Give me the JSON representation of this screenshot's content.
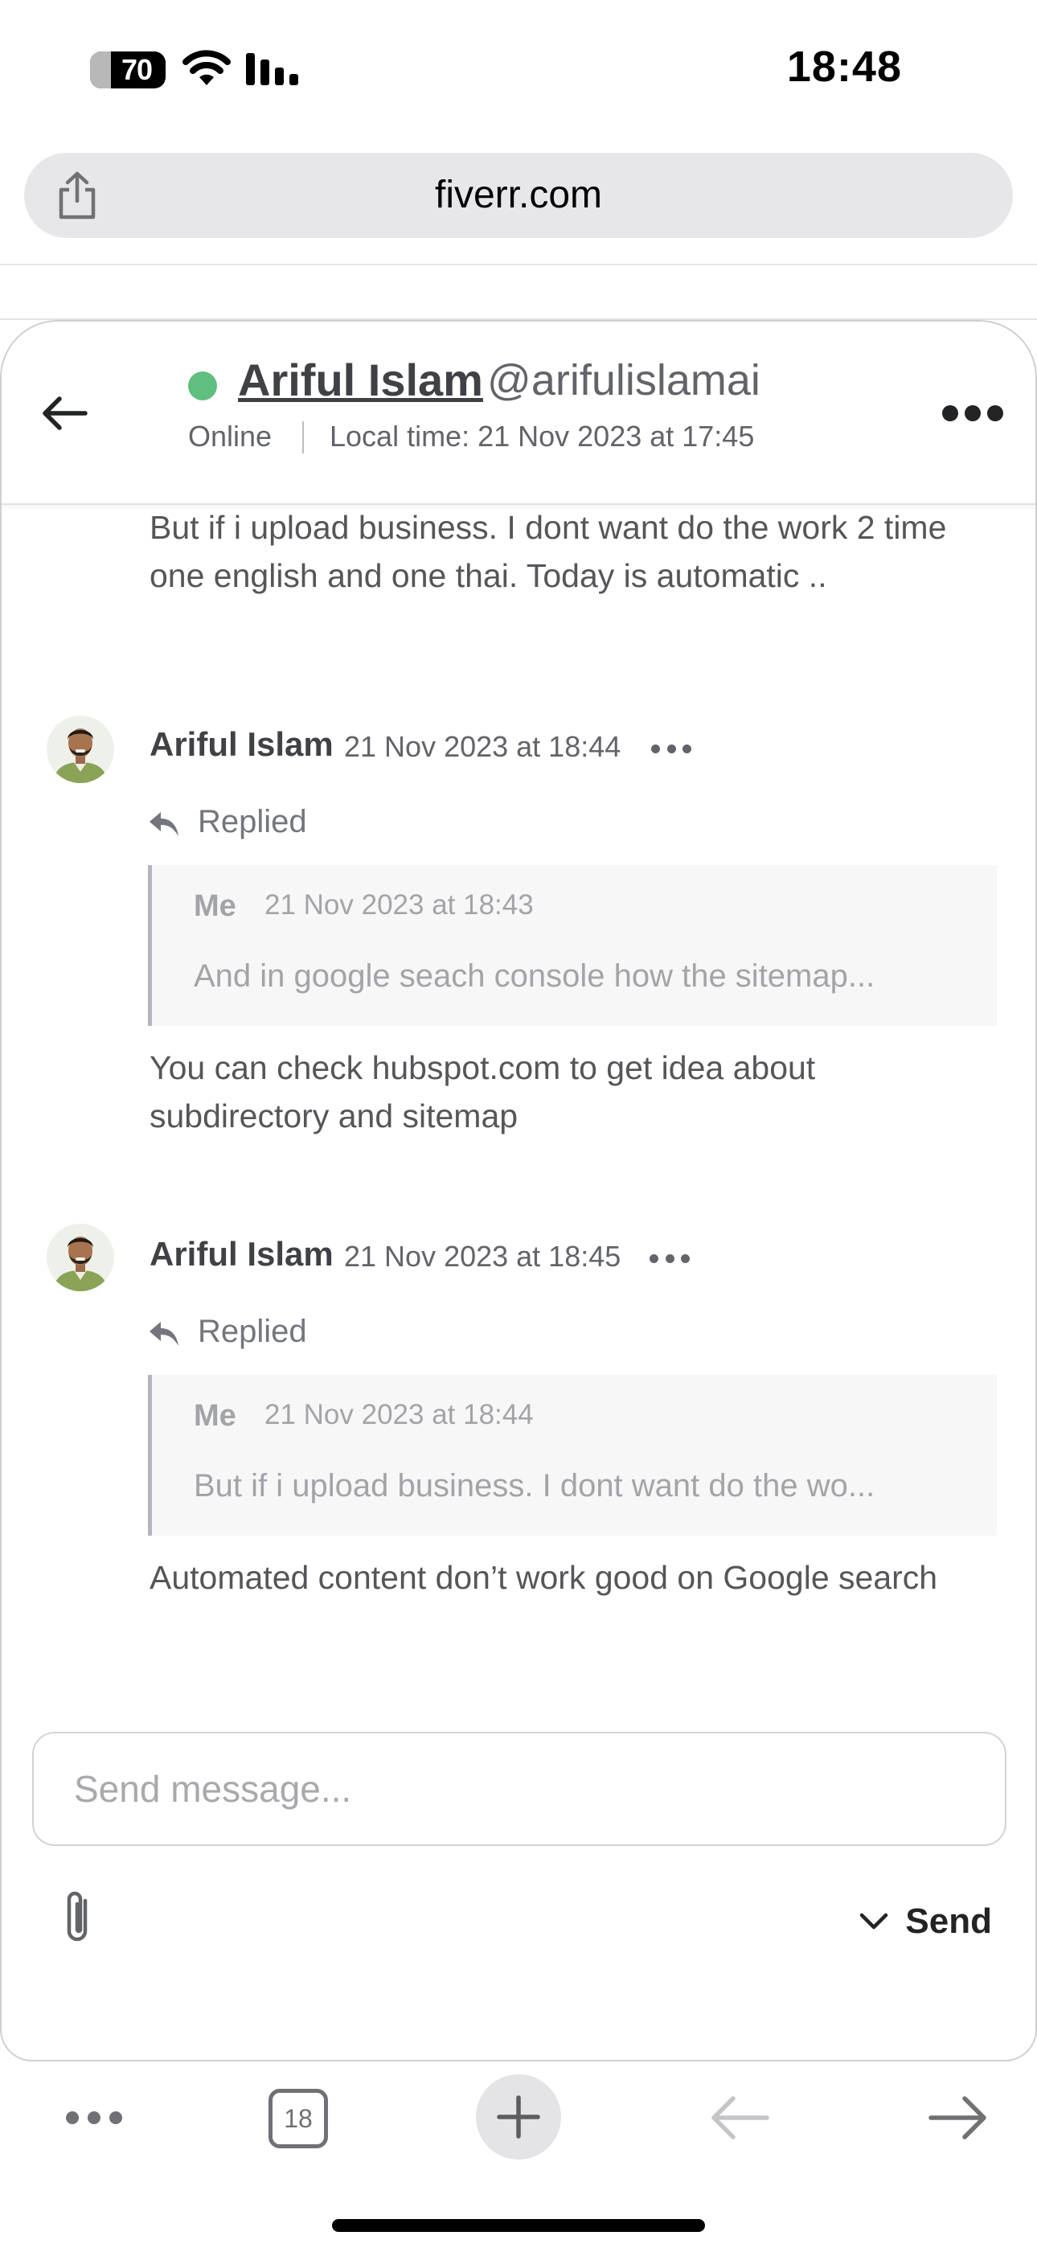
{
  "status_bar": {
    "battery": "70",
    "time": "18:48",
    "icons": [
      "battery-icon",
      "wifi-icon",
      "cellular-signal-icon"
    ]
  },
  "browser": {
    "url": "fiverr.com",
    "share_icon": "share-icon"
  },
  "chat_header": {
    "name": "Ariful Islam",
    "handle": "@arifulislamai",
    "status": "Online",
    "local_time": "Local time: 21 Nov 2023 at 17:45",
    "presence_color": "#5fbf7f"
  },
  "messages": {
    "previous_text": "But if i upload business. I dont want do the work 2 time one english and one thai. Today is automatic ..",
    "items": [
      {
        "sender": "Ariful Islam",
        "timestamp": "21 Nov 2023 at 18:44",
        "replied_label": "Replied",
        "quote": {
          "sender": "Me",
          "timestamp": "21 Nov 2023 at 18:43",
          "text": "And in google seach console how the sitemap..."
        },
        "text": "You can check hubspot.com to get idea about subdirectory and sitemap"
      },
      {
        "sender": "Ariful Islam",
        "timestamp": "21 Nov 2023 at 18:45",
        "replied_label": "Replied",
        "quote": {
          "sender": "Me",
          "timestamp": "21 Nov 2023 at 18:44",
          "text": "But if i upload business. I dont want do the wo..."
        },
        "text": "Automated content don’t work good on Google search"
      }
    ]
  },
  "composer": {
    "placeholder": "Send message...",
    "value": "",
    "send_label": "Send"
  },
  "toolbar": {
    "tab_count": "18",
    "icons": [
      "more-icon",
      "tabs-icon",
      "plus-icon",
      "back-arrow-icon",
      "forward-arrow-icon"
    ]
  }
}
